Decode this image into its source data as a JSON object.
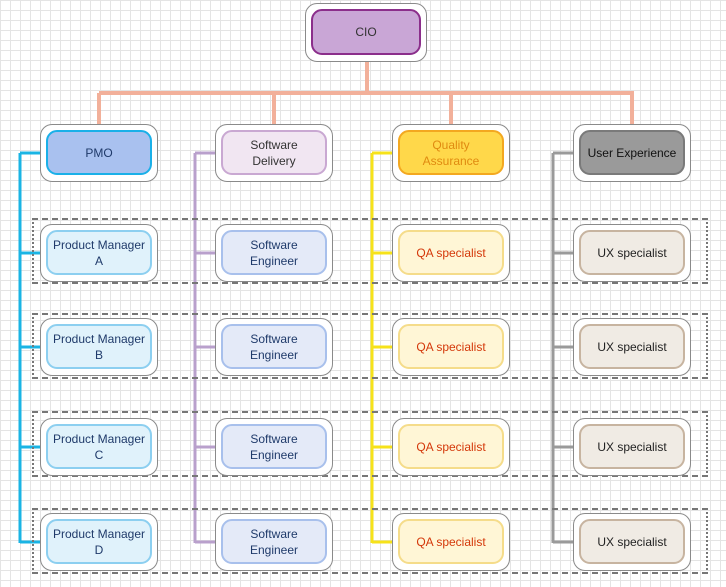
{
  "root": {
    "label": "CIO",
    "fill": "#c9a6d6",
    "border": "#8b2e8b",
    "text": "#333333",
    "connector": "#f2b09a"
  },
  "columns": [
    {
      "label": "PMO",
      "fill": "#a9c1ef",
      "border": "#1ab0e8",
      "text": "#1f3a6a",
      "line": "#1ab4e4",
      "child_fill": "#e0f2fb",
      "child_border": "#8ccff0",
      "child_text": "#1f3a6a",
      "children": [
        "Product Manager A",
        "Product Manager B",
        "Product Manager C",
        "Product Manager D"
      ]
    },
    {
      "label": "Software Delivery",
      "fill": "#f1e6f2",
      "border": "#c9a8d2",
      "text": "#333333",
      "line": "#b9a0cc",
      "child_fill": "#e4eaf8",
      "child_border": "#a8c0ec",
      "child_text": "#1f3a6a",
      "children": [
        "Software Engineer",
        "Software Engineer",
        "Software Engineer",
        "Software Engineer"
      ]
    },
    {
      "label": "Quality Assurance",
      "fill": "#ffd84a",
      "border": "#f3a820",
      "text": "#e08a10",
      "line": "#f6e21a",
      "child_fill": "#fff6d6",
      "child_border": "#f5dc8a",
      "child_text": "#d4380a",
      "children": [
        "QA specialist",
        "QA specialist",
        "QA specialist",
        "QA specialist"
      ]
    },
    {
      "label": "User Experience",
      "fill": "#9a9a9a",
      "border": "#7a7a7a",
      "text": "#111111",
      "line": "#9a9a9a",
      "child_fill": "#f0ebe4",
      "child_border": "#c7b4a0",
      "child_text": "#222222",
      "children": [
        "UX specialist",
        "UX specialist",
        "UX specialist",
        "UX specialist"
      ]
    }
  ]
}
